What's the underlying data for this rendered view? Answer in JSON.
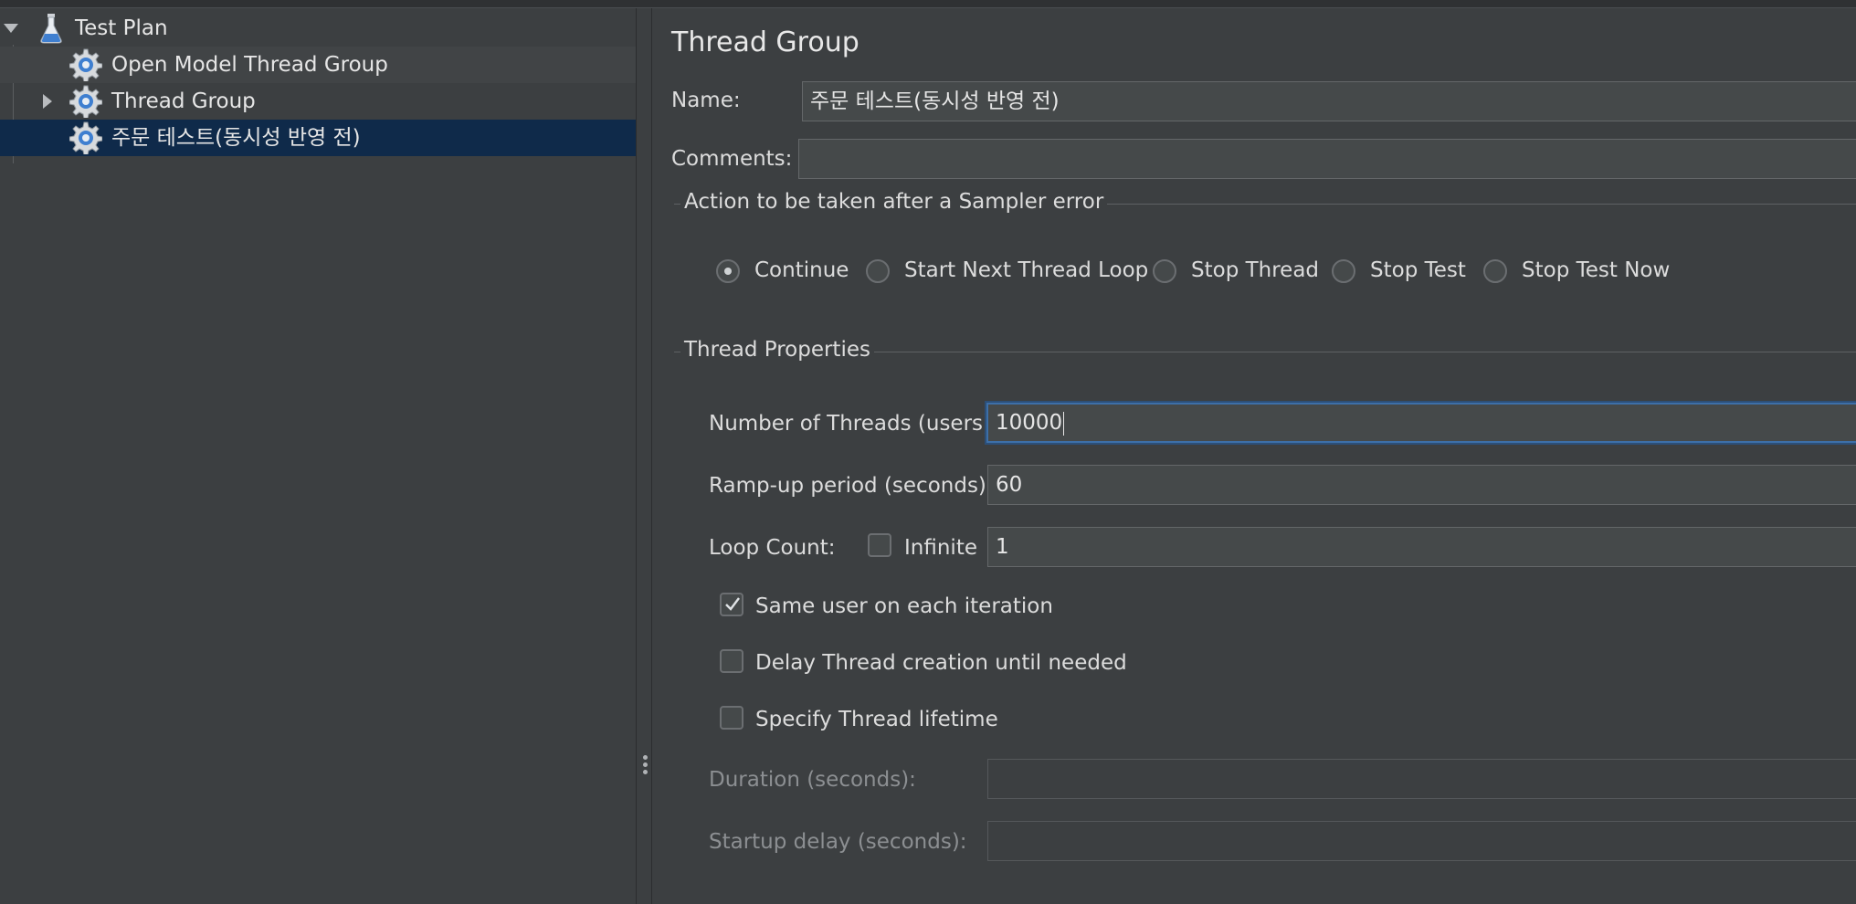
{
  "tree": {
    "items": [
      {
        "label": "Test Plan",
        "icon": "flask-icon",
        "expanded": true
      },
      {
        "label": "Open Model Thread Group",
        "icon": "gear-icon"
      },
      {
        "label": "Thread Group",
        "icon": "gear-icon",
        "expanded": false
      },
      {
        "label": "주문 테스트(동시성 반영 전)",
        "icon": "gear-icon",
        "selected": true
      }
    ]
  },
  "panel": {
    "title": "Thread Group",
    "name_label": "Name:",
    "name_value": "주문 테스트(동시성 반영 전)",
    "comments_label": "Comments:",
    "comments_value": "",
    "sampler_error": {
      "title": "Action to be taken after a Sampler error",
      "options": [
        "Continue",
        "Start Next Thread Loop",
        "Stop Thread",
        "Stop Test",
        "Stop Test Now"
      ],
      "selected": "Continue"
    },
    "thread_properties": {
      "title": "Thread Properties",
      "threads_label": "Number of Threads (users):",
      "threads_value": "10000",
      "rampup_label": "Ramp-up period (seconds):",
      "rampup_value": "60",
      "loop_label": "Loop Count:",
      "infinite_label": "Infinite",
      "infinite_checked": false,
      "loop_value": "1",
      "same_user_label": "Same user on each iteration",
      "same_user_checked": true,
      "delay_label": "Delay Thread creation until needed",
      "delay_checked": false,
      "lifetime_label": "Specify Thread lifetime",
      "lifetime_checked": false,
      "duration_label": "Duration (seconds):",
      "duration_value": "",
      "startup_label": "Startup delay (seconds):",
      "startup_value": ""
    }
  },
  "colors": {
    "background": "#3c3f41",
    "selection": "#0f2a4a",
    "focus_border": "#3d6fa8",
    "gear_blue": "#3f7fd0"
  }
}
